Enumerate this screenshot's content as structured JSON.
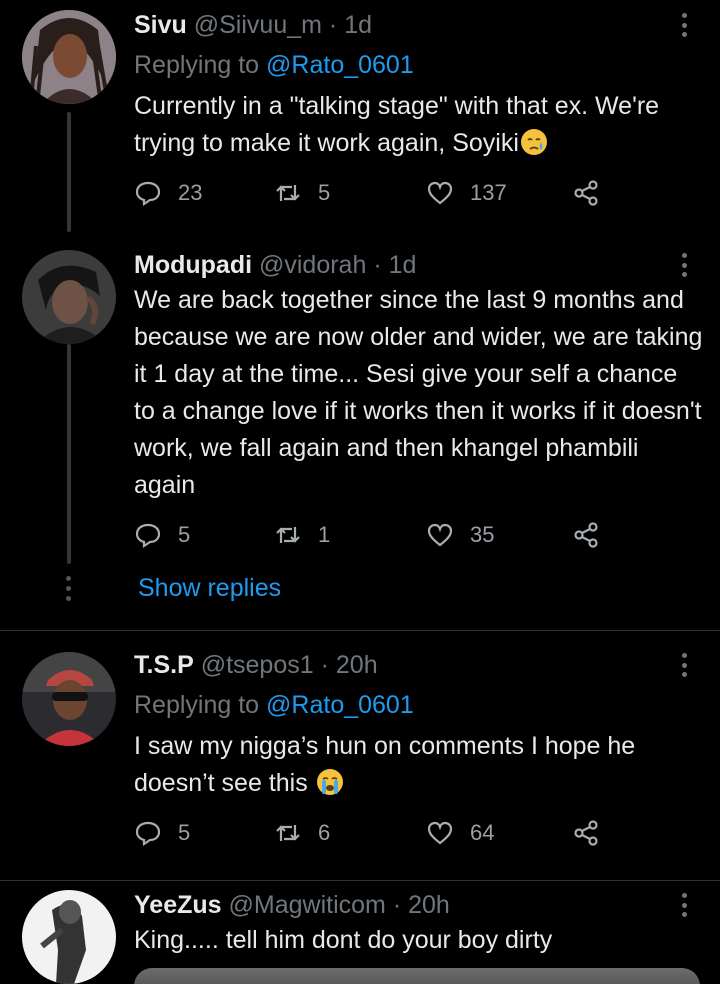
{
  "tweets": [
    {
      "name": "Sivu",
      "handle": "@Siivuu_m",
      "time": "1d",
      "replying_prefix": "Replying to",
      "replying_to": "@Rato_0601",
      "text": "Currently in a \"talking stage\" with that ex. We're trying to make it work again, Soyiki",
      "emoji": "crying-face",
      "replies": "23",
      "retweets": "5",
      "likes": "137"
    },
    {
      "name": "Modupadi",
      "handle": "@vidorah",
      "time": "1d",
      "text": "We are back together since the last 9 months and because we are now older and wider, we are taking it 1 day at the time... Sesi give your self a chance to a change love if it works then it works if it doesn't work, we fall again and then khangel phambili again",
      "replies": "5",
      "retweets": "1",
      "likes": "35",
      "show_replies": "Show replies"
    },
    {
      "name": "T.S.P",
      "handle": "@tsepos1",
      "time": "20h",
      "replying_prefix": "Replying to",
      "replying_to": "@Rato_0601",
      "text": "I saw my nigga’s hun on comments I hope he doesn’t see this",
      "emoji": "loudly-crying-face",
      "replies": "5",
      "retweets": "6",
      "likes": "64"
    },
    {
      "name": "YeeZus",
      "handle": "@Magwiticom",
      "time": "20h",
      "text": "King..... tell him dont do your boy dirty"
    }
  ],
  "separator": "·",
  "colors": {
    "background": "#000000",
    "link": "#1d9bf0",
    "muted": "#71767b"
  }
}
